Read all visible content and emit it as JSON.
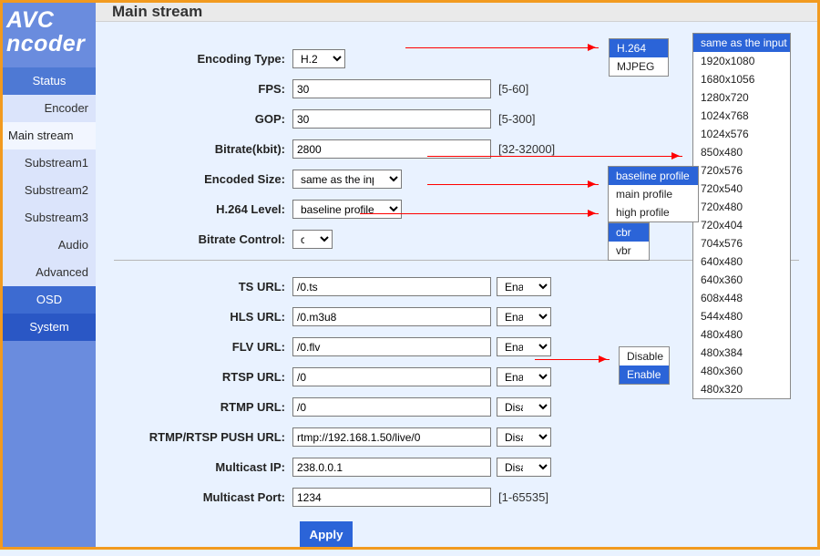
{
  "sidebar": {
    "logo1": "AVC",
    "logo2": "ncoder",
    "items": [
      "Status",
      "Encoder",
      "Main stream",
      "Substream1",
      "Substream2",
      "Substream3",
      "Audio",
      "Advanced",
      "OSD",
      "System"
    ]
  },
  "title": "Main stream",
  "labels": {
    "encType": "Encoding Type:",
    "fps": "FPS:",
    "gop": "GOP:",
    "bitrate": "Bitrate(kbit):",
    "encSize": "Encoded Size:",
    "level": "H.264 Level:",
    "bctrl": "Bitrate Control:",
    "ts": "TS URL:",
    "hls": "HLS URL:",
    "flv": "FLV URL:",
    "rtsp": "RTSP URL:",
    "rtmp": "RTMP URL:",
    "push": "RTMP/RTSP PUSH URL:",
    "multiIp": "Multicast IP:",
    "multiPort": "Multicast Port:",
    "apply": "Apply"
  },
  "values": {
    "encType": "H.264",
    "fps": "30",
    "gop": "30",
    "bitrate": "2800",
    "encSize": "same as the input",
    "level": "baseline profile",
    "bctrl": "cbr",
    "ts": "/0.ts",
    "tsSel": "Enable",
    "hls": "/0.m3u8",
    "hlsSel": "Enable",
    "flv": "/0.flv",
    "flvSel": "Enable",
    "rtsp": "/0",
    "rtspSel": "Enable",
    "rtmp": "/0",
    "rtmpSel": "Disable",
    "push": "rtmp://192.168.1.50/live/0",
    "pushSel": "Disable",
    "multiIp": "238.0.0.1",
    "multiIpSel": "Disable",
    "multiPort": "1234"
  },
  "hints": {
    "fps": "[5-60]",
    "gop": "[5-300]",
    "bitrate": "[32-32000]",
    "multiPort": "[1-65535]"
  },
  "pops": {
    "enc": [
      "H.264",
      "MJPEG"
    ],
    "size": [
      "same as the input",
      "1920x1080",
      "1680x1056",
      "1280x720",
      "1024x768",
      "1024x576",
      "850x480",
      "720x576",
      "720x540",
      "720x480",
      "720x404",
      "704x576",
      "640x480",
      "640x360",
      "608x448",
      "544x480",
      "480x480",
      "480x384",
      "480x360",
      "480x320"
    ],
    "level": [
      "baseline profile",
      "main profile",
      "high profile"
    ],
    "bctrl": [
      "cbr",
      "vbr"
    ],
    "ende": [
      "Disable",
      "Enable"
    ]
  }
}
